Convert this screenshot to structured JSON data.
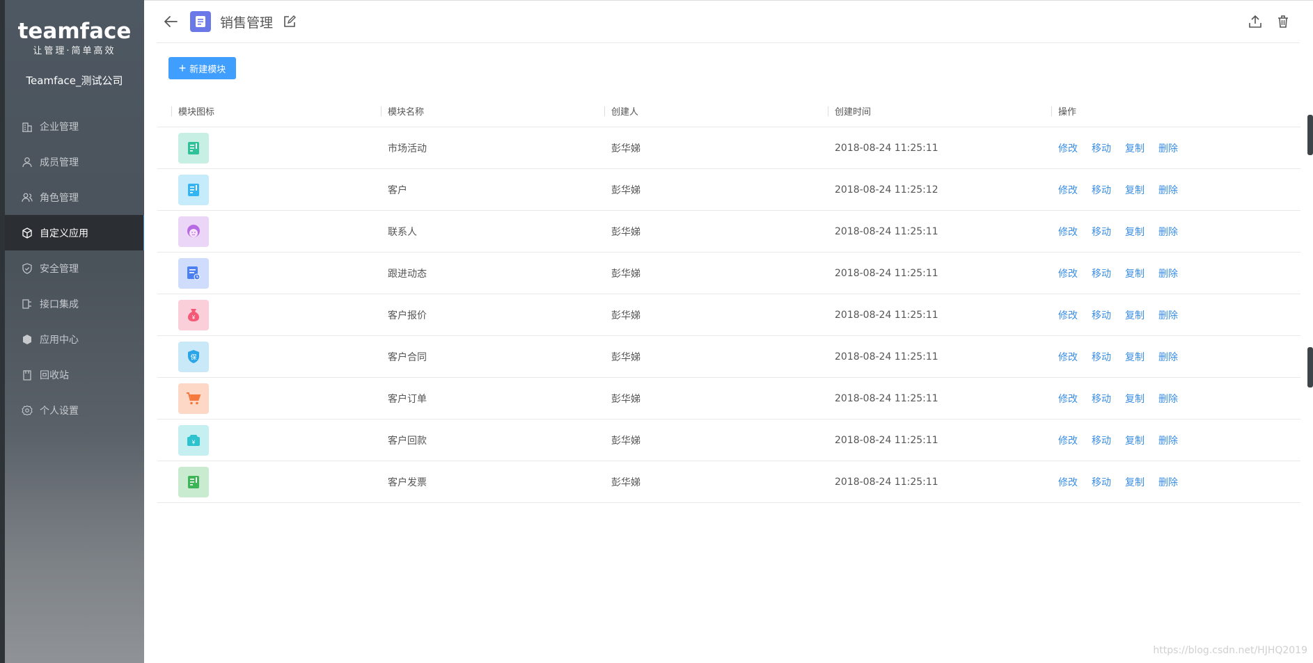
{
  "sidebar": {
    "logo": "teamface",
    "slogan": "让管理·简单高效",
    "company": "Teamface_测试公司",
    "items": [
      {
        "label": "企业管理",
        "icon": "building-icon"
      },
      {
        "label": "成员管理",
        "icon": "user-icon"
      },
      {
        "label": "角色管理",
        "icon": "users-icon"
      },
      {
        "label": "自定义应用",
        "icon": "cube-icon",
        "active": true
      },
      {
        "label": "安全管理",
        "icon": "shield-icon"
      },
      {
        "label": "接口集成",
        "icon": "plug-icon"
      },
      {
        "label": "应用中心",
        "icon": "box-icon"
      },
      {
        "label": "回收站",
        "icon": "trash-icon"
      },
      {
        "label": "个人设置",
        "icon": "gear-icon"
      }
    ]
  },
  "header": {
    "title": "销售管理"
  },
  "toolbar": {
    "new_module": "新建模块"
  },
  "table": {
    "columns": [
      "模块图标",
      "模块名称",
      "创建人",
      "创建时间",
      "操作"
    ],
    "actions": [
      "修改",
      "移动",
      "复制",
      "删除"
    ],
    "rows": [
      {
        "name": "市场活动",
        "creator": "彭华娣",
        "time": "2018-08-24 11:25:11",
        "icon": "note-icon",
        "color": "#2fc29a",
        "bg": "#c8efe3"
      },
      {
        "name": "客户",
        "creator": "彭华娣",
        "time": "2018-08-24 11:25:12",
        "icon": "note-icon",
        "color": "#35b4f2",
        "bg": "#c6ebfb"
      },
      {
        "name": "联系人",
        "creator": "彭华娣",
        "time": "2018-08-24 11:25:11",
        "icon": "person-face-icon",
        "color": "#b76be2",
        "bg": "#ecd6f7"
      },
      {
        "name": "跟进动态",
        "creator": "彭华娣",
        "time": "2018-08-24 11:25:11",
        "icon": "doc-clock-icon",
        "color": "#4c7ff0",
        "bg": "#cfdcfb"
      },
      {
        "name": "客户报价",
        "creator": "彭华娣",
        "time": "2018-08-24 11:25:11",
        "icon": "money-bag-icon",
        "color": "#f45a78",
        "bg": "#fbcfd9"
      },
      {
        "name": "客户合同",
        "creator": "彭华娣",
        "time": "2018-08-24 11:25:11",
        "icon": "shield-bao-icon",
        "color": "#2aa5e8",
        "bg": "#c9e8f8"
      },
      {
        "name": "客户订单",
        "creator": "彭华娣",
        "time": "2018-08-24 11:25:11",
        "icon": "cart-icon",
        "color": "#f5783c",
        "bg": "#fdd8c7"
      },
      {
        "name": "客户回款",
        "creator": "彭华娣",
        "time": "2018-08-24 11:25:11",
        "icon": "yen-box-icon",
        "color": "#2cc3cf",
        "bg": "#c6eff2"
      },
      {
        "name": "客户发票",
        "creator": "彭华娣",
        "time": "2018-08-24 11:25:11",
        "icon": "note-icon",
        "color": "#3db556",
        "bg": "#c9ebcf"
      }
    ]
  },
  "watermark": "https://blog.csdn.net/HJHQ2019"
}
